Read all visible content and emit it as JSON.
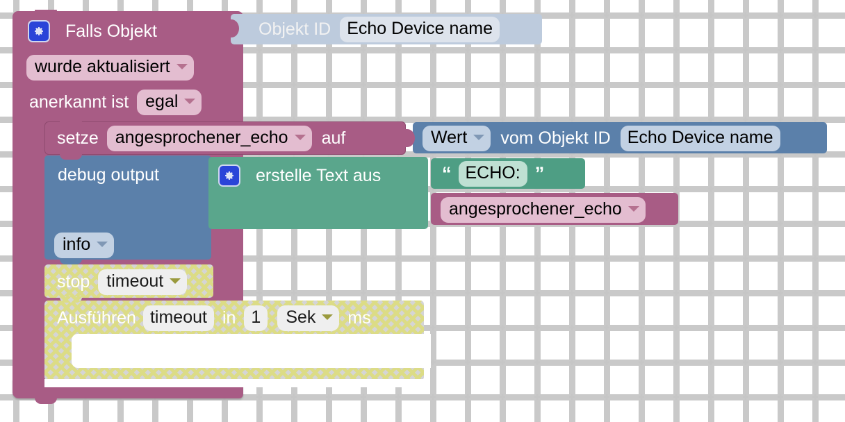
{
  "workspace": {
    "name": "blockly-workspace",
    "background": "#ffffff",
    "grid_color": "#c9c9c9",
    "grid_spacing": 50
  },
  "colors": {
    "trigger_magenta": "#a85c85",
    "variable_magenta": "#a85c85",
    "variable_field": "#e3bdd0",
    "object_id_block": "#bdcbdd",
    "object_id_field": "#dde3ec",
    "debug_blue": "#5b80aa",
    "debug_field": "#c2d1e3",
    "text_green": "#5aa68c",
    "text_field": "#bfe0d3",
    "gear_blue": "#2a44d8",
    "disabled_gray": "#d5d5d5",
    "disabled_hatch": "#dcdc86"
  },
  "blocks": {
    "trigger": {
      "name": "on-object-change-block",
      "gear_icon": "gear-icon",
      "title": "Falls Objekt",
      "objekt_id": {
        "label": "Objekt ID",
        "value": "Echo Device name"
      },
      "change_mode": "wurde aktualisiert",
      "ack_label": "anerkannt ist",
      "ack_value": "egal"
    },
    "set_variable": {
      "name": "set-variable-block",
      "keyword": "setze",
      "variable": "angesprochener_echo",
      "to_label": "auf",
      "value_block": {
        "name": "get-object-value-block",
        "attribute": "Wert",
        "label": "vom Objekt ID",
        "object_id": "Echo Device name"
      }
    },
    "debug": {
      "name": "debug-output-block",
      "label": "debug output",
      "severity": "info",
      "text_block": {
        "name": "create-text-block",
        "gear_icon": "gear-icon",
        "title": "erstelle Text aus",
        "items": [
          {
            "name": "text-literal",
            "type": "text",
            "value": "ECHO: ",
            "open_quote": "“",
            "close_quote": "”"
          },
          {
            "name": "variable-getter",
            "type": "variable",
            "value": "angesprochener_echo"
          }
        ]
      }
    },
    "stop_timeout": {
      "name": "clear-timeout-block",
      "disabled": true,
      "keyword": "stop",
      "timeout_name": "timeout"
    },
    "run_timeout": {
      "name": "set-timeout-block",
      "disabled": true,
      "keyword": "Ausführen",
      "timeout_name": "timeout",
      "in_label": "in",
      "delay": "1",
      "unit": "Sek",
      "unit_suffix": "ms",
      "body": []
    }
  }
}
